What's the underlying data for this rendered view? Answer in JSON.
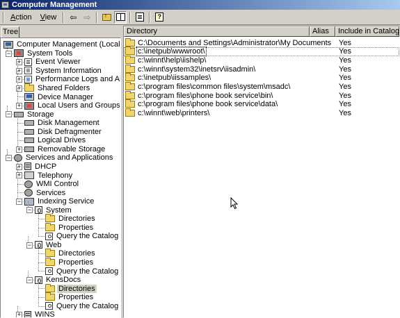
{
  "window": {
    "title": "Computer Management"
  },
  "menu": {
    "action": "Action",
    "view": "View"
  },
  "toolbar": {
    "back_icon": "back-arrow-icon",
    "forward_icon": "forward-arrow-icon",
    "up_icon": "folder-up-icon",
    "tree_icon": "show-tree-icon",
    "export_icon": "export-list-icon",
    "help_icon": "help-icon"
  },
  "tabs": {
    "tree": "Tree"
  },
  "tree": [
    {
      "label": "Computer Management (Local)",
      "icon": "computer",
      "expander": ""
    },
    {
      "label": "System Tools",
      "icon": "tools",
      "expander": "-"
    },
    {
      "label": "Event Viewer",
      "icon": "doc",
      "expander": "+"
    },
    {
      "label": "System Information",
      "icon": "doc",
      "expander": "+"
    },
    {
      "label": "Performance Logs and Alerts",
      "icon": "doc",
      "expander": "+"
    },
    {
      "label": "Shared Folders",
      "icon": "folder",
      "expander": "+"
    },
    {
      "label": "Device Manager",
      "icon": "computer",
      "expander": ""
    },
    {
      "label": "Local Users and Groups",
      "icon": "tools",
      "expander": "+"
    },
    {
      "label": "Storage",
      "icon": "disk",
      "expander": "-"
    },
    {
      "label": "Disk Management",
      "icon": "disk",
      "expander": ""
    },
    {
      "label": "Disk Defragmenter",
      "icon": "disk",
      "expander": ""
    },
    {
      "label": "Logical Drives",
      "icon": "disk",
      "expander": ""
    },
    {
      "label": "Removable Storage",
      "icon": "disk",
      "expander": "+"
    },
    {
      "label": "Services and Applications",
      "icon": "gear",
      "expander": "-"
    },
    {
      "label": "DHCP",
      "icon": "server",
      "expander": "+"
    },
    {
      "label": "Telephony",
      "icon": "phone",
      "expander": "+"
    },
    {
      "label": "WMI Control",
      "icon": "gear",
      "expander": ""
    },
    {
      "label": "Services",
      "icon": "gear",
      "expander": ""
    },
    {
      "label": "Indexing Service",
      "icon": "hdr",
      "expander": "-"
    },
    {
      "label": "System",
      "icon": "catalog",
      "expander": "-"
    },
    {
      "label": "Directories",
      "icon": "folder",
      "expander": ""
    },
    {
      "label": "Properties",
      "icon": "folder",
      "expander": ""
    },
    {
      "label": "Query the Catalog",
      "icon": "query",
      "expander": ""
    },
    {
      "label": "Web",
      "icon": "catalog",
      "expander": "-"
    },
    {
      "label": "Directories",
      "icon": "folder",
      "expander": ""
    },
    {
      "label": "Properties",
      "icon": "folder",
      "expander": ""
    },
    {
      "label": "Query the Catalog",
      "icon": "query",
      "expander": ""
    },
    {
      "label": "KensDocs",
      "icon": "catalog",
      "expander": "-"
    },
    {
      "label": "Directories",
      "icon": "folder",
      "expander": "",
      "selected": true
    },
    {
      "label": "Properties",
      "icon": "folder",
      "expander": ""
    },
    {
      "label": "Query the Catalog",
      "icon": "query",
      "expander": ""
    },
    {
      "label": "WINS",
      "icon": "server",
      "expander": "+"
    }
  ],
  "list": {
    "columns": [
      "Directory",
      "Alias",
      "Include in Catalog"
    ],
    "rows": [
      {
        "directory": "C:\\Documents and Settings\\Administrator\\My Documents",
        "alias": "",
        "include": "Yes"
      },
      {
        "directory": "c:\\inetpub\\wwwroot\\",
        "alias": "",
        "include": "Yes",
        "focused": true
      },
      {
        "directory": "c:\\winnt\\help\\iishelp\\",
        "alias": "",
        "include": "Yes"
      },
      {
        "directory": "c:\\winnt\\system32\\inetsrv\\iisadmin\\",
        "alias": "",
        "include": "Yes"
      },
      {
        "directory": "c:\\inetpub\\iissamples\\",
        "alias": "",
        "include": "Yes"
      },
      {
        "directory": "c:\\program files\\common files\\system\\msadc\\",
        "alias": "",
        "include": "Yes"
      },
      {
        "directory": "c:\\program files\\phone book service\\bin\\",
        "alias": "",
        "include": "Yes"
      },
      {
        "directory": "c:\\program files\\phone book service\\data\\",
        "alias": "",
        "include": "Yes"
      },
      {
        "directory": "c:\\winnt\\web\\printers\\",
        "alias": "",
        "include": "Yes"
      }
    ]
  }
}
